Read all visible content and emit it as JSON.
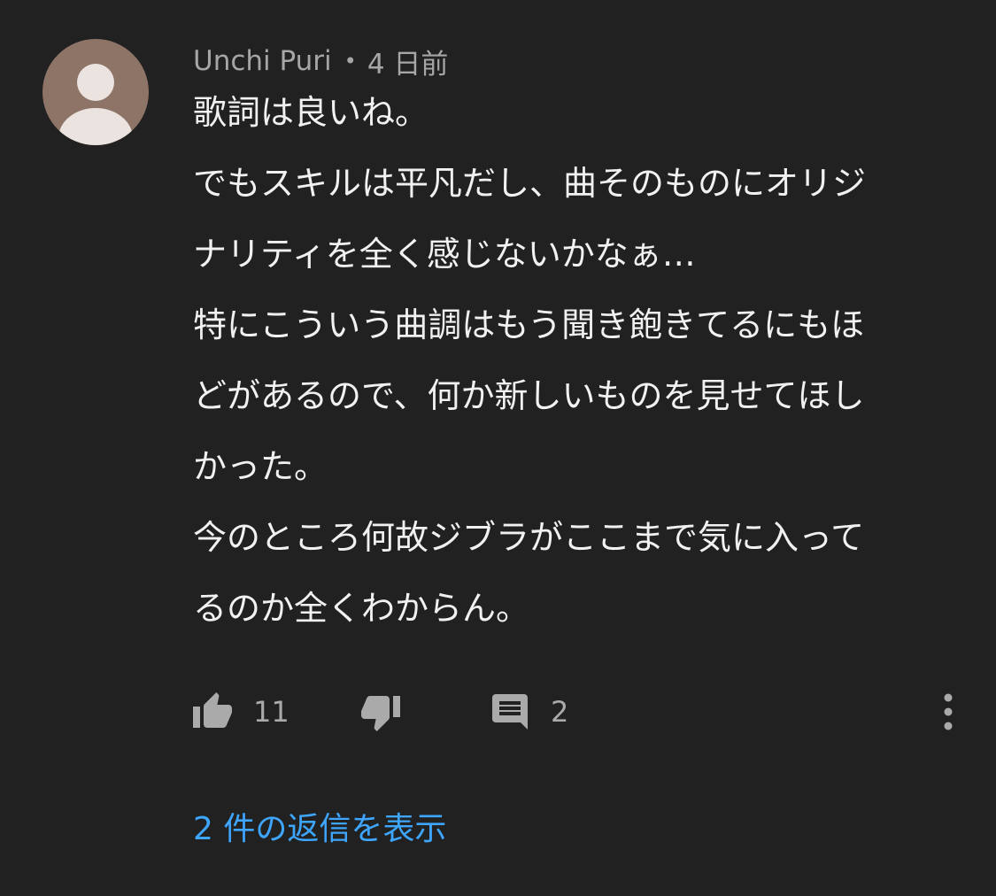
{
  "comment": {
    "author": "Unchi Puri",
    "separator": "•",
    "posted": "4 日前",
    "text_lines": [
      "歌詞は良いね。",
      "でもスキルは平凡だし、曲そのものにオリジ",
      "ナリティを全く感じないかなぁ…",
      "特にこういう曲調はもう聞き飽きてるにもほ",
      "どがあるので、何か新しいものを見せてほし",
      "かった。",
      "今のところ何故ジブラがここまで気に入って",
      "るのか全くわからん。"
    ],
    "likes": "11",
    "replies_count": "2",
    "view_replies_label": "2 件の返信を表示"
  },
  "icons": {
    "avatar": "default-avatar-icon",
    "like": "thumbs-up-icon",
    "dislike": "thumbs-down-icon",
    "reply": "comment-icon",
    "more": "more-vert-icon"
  },
  "colors": {
    "background": "#212121",
    "text": "#f1f1f1",
    "secondary": "#aaaaaa",
    "link": "#3ea6ff",
    "avatar": "#8d7466"
  }
}
